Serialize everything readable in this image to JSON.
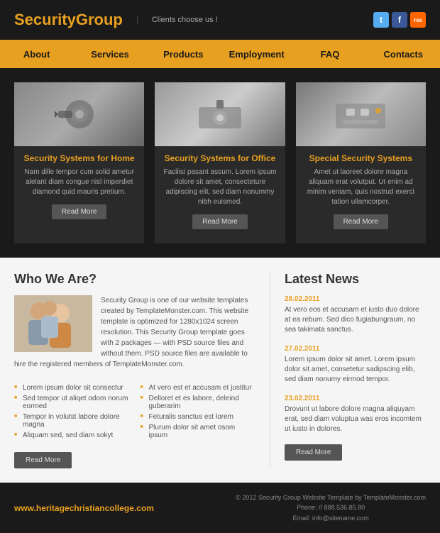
{
  "header": {
    "logo_text": "Security",
    "logo_highlight": "Group",
    "tagline": "Clients choose us !",
    "social": {
      "twitter_label": "t",
      "facebook_label": "f",
      "rss_label": "rss"
    }
  },
  "nav": {
    "items": [
      {
        "label": "About"
      },
      {
        "label": "Services"
      },
      {
        "label": "Products"
      },
      {
        "label": "Employment"
      },
      {
        "label": "FAQ"
      },
      {
        "label": "Contacts"
      }
    ]
  },
  "features": [
    {
      "title": "Security Systems for Home",
      "text": "Nam dille tempor cum solid ametur alelant diam congue nisl imperdiet diamond quid mauris pretium.",
      "btn": "Read More"
    },
    {
      "title": "Security Systems for Office",
      "text": "Facilisi pasant assum. Lorem ipsum dolore sit amet, consecteture adipiscing elit, sed diam nonummy nibh euismed.",
      "btn": "Read More"
    },
    {
      "title": "Special Security Systems",
      "text": "Amet ut laoreet dolore magna aliquam erat volutput. Ut enim ad minim veniam, quis nostrud exerci tation ullamcorper.",
      "btn": "Read More"
    }
  ],
  "who_we_are": {
    "title": "Who We Are?",
    "body": "Security Group is one of our website templates created by TemplateMonster.com. This website template is optimized for 1280x1024 screen resolution. This Security Group template goes with 2 packages — with PSD source files and without them. PSD source files are available to hire the registered members of TemplateMonster.com.",
    "link_text": "our website templates",
    "bullets_left": [
      "Lorem ipsum dolor sit consectur",
      "Sed tempor ut aliqet odom norum eormed",
      "Tempor in volutst labore dolore magna",
      "Aliquam sed, sed diam sokyt"
    ],
    "bullets_right": [
      "At vero est et accusam et justitur",
      "Delloret et es labore, deleind guberarim",
      "Feturalis sanctus est lorem",
      "Plurum dolor sit amet osom ipsum"
    ],
    "btn": "Read More"
  },
  "latest_news": {
    "title": "Latest News",
    "items": [
      {
        "date": "28.02.2011",
        "text": "At vero eos et accusam et iusto duo dolore at ea rebum. Sed dico fugiabungraum, no sea takimata sanctus."
      },
      {
        "date": "27.02.2011",
        "text": "Lorem ipsum dolor sit amet. Lorem ipsum dolor sit amet, consetetur sadipscing elib, sed diam nonumy eirmod tempor."
      },
      {
        "date": "23.02.2011",
        "text": "Drovunt ut labore dolore magna aliquyam erat, sed diam voluptua was eros incomtem ut iusto in dolores."
      }
    ],
    "btn": "Read More"
  },
  "footer": {
    "url": "www.heritagechristiancollege.com",
    "copyright": "© 2012 Security Group Website Template by TemplateMonster.com",
    "phone": "Phone: // 888.536.85.80",
    "email": "Email: info@sitename.com"
  }
}
